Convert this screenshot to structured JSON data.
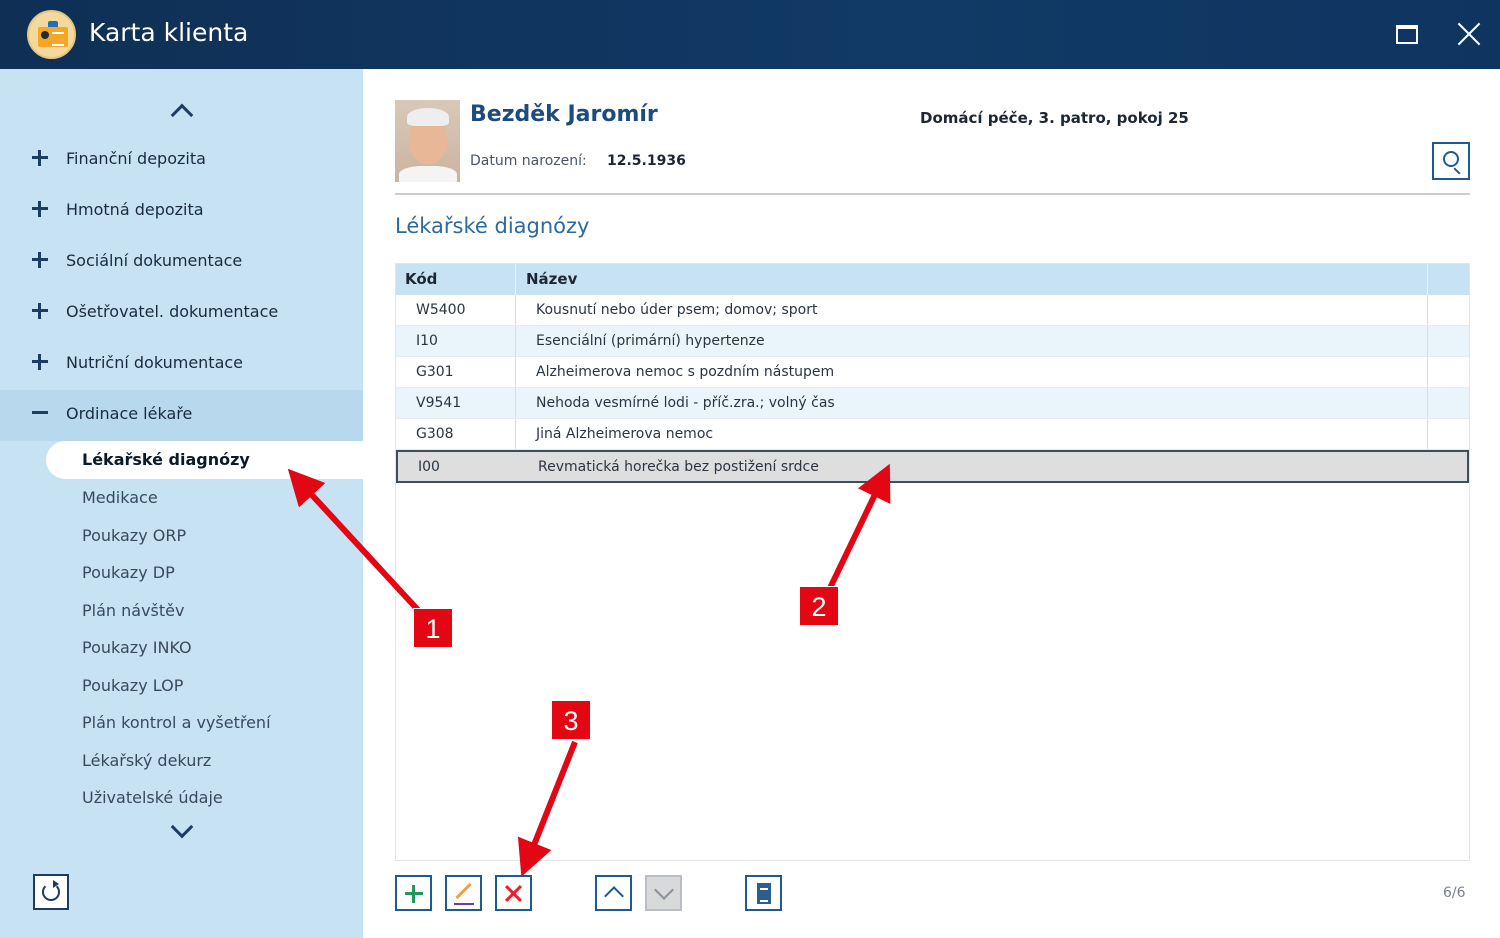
{
  "window": {
    "title": "Karta klienta"
  },
  "sidebar": {
    "sections": [
      {
        "label": "Finanční depozita",
        "state": "collapsed"
      },
      {
        "label": "Hmotná depozita",
        "state": "collapsed"
      },
      {
        "label": "Sociální dokumentace",
        "state": "collapsed"
      },
      {
        "label": "Ošetřovatel. dokumentace",
        "state": "collapsed"
      },
      {
        "label": "Nutriční dokumentace",
        "state": "collapsed"
      },
      {
        "label": "Ordinace lékaře",
        "state": "expanded"
      }
    ],
    "subitems": [
      {
        "label": "Lékařské diagnózy",
        "active": true
      },
      {
        "label": "Medikace"
      },
      {
        "label": "Poukazy ORP"
      },
      {
        "label": "Poukazy DP"
      },
      {
        "label": "Plán návštěv"
      },
      {
        "label": "Poukazy INKO"
      },
      {
        "label": "Poukazy LOP"
      },
      {
        "label": "Plán kontrol a vyšetření"
      },
      {
        "label": "Lékařský dekurz"
      },
      {
        "label": "Uživatelské údaje"
      }
    ]
  },
  "client": {
    "name": "Bezděk Jaromír",
    "dob_label": "Datum narození:",
    "dob": "12.5.1936",
    "location": "Domácí péče, 3. patro, pokoj 25"
  },
  "section_title": "Lékařské diagnózy",
  "table": {
    "columns": [
      "Kód",
      "Název"
    ],
    "rows": [
      {
        "code": "W5400",
        "name": "Kousnutí nebo úder psem; domov; sport"
      },
      {
        "code": "I10",
        "name": "Esenciální (primární) hypertenze"
      },
      {
        "code": "G301",
        "name": "Alzheimerova nemoc s pozdním nástupem"
      },
      {
        "code": "V9541",
        "name": "Nehoda vesmírné lodi - příč.zra.; volný čas"
      },
      {
        "code": "G308",
        "name": "Jiná Alzheimerova nemoc"
      },
      {
        "code": "I00",
        "name": "Revmatická horečka bez postižení srdce",
        "selected": true
      }
    ]
  },
  "toolbar": {
    "counter": "6/6",
    "icons": [
      "add-icon",
      "edit-icon",
      "delete-icon",
      "move-up-icon",
      "move-down-icon",
      "document-icon"
    ]
  },
  "annotations": {
    "badges": [
      "1",
      "2",
      "3"
    ],
    "color": "#e30613"
  },
  "colors": {
    "titlebar": "#113a66",
    "sidebar": "#c6e2f3",
    "accent": "#2c6aa0"
  }
}
